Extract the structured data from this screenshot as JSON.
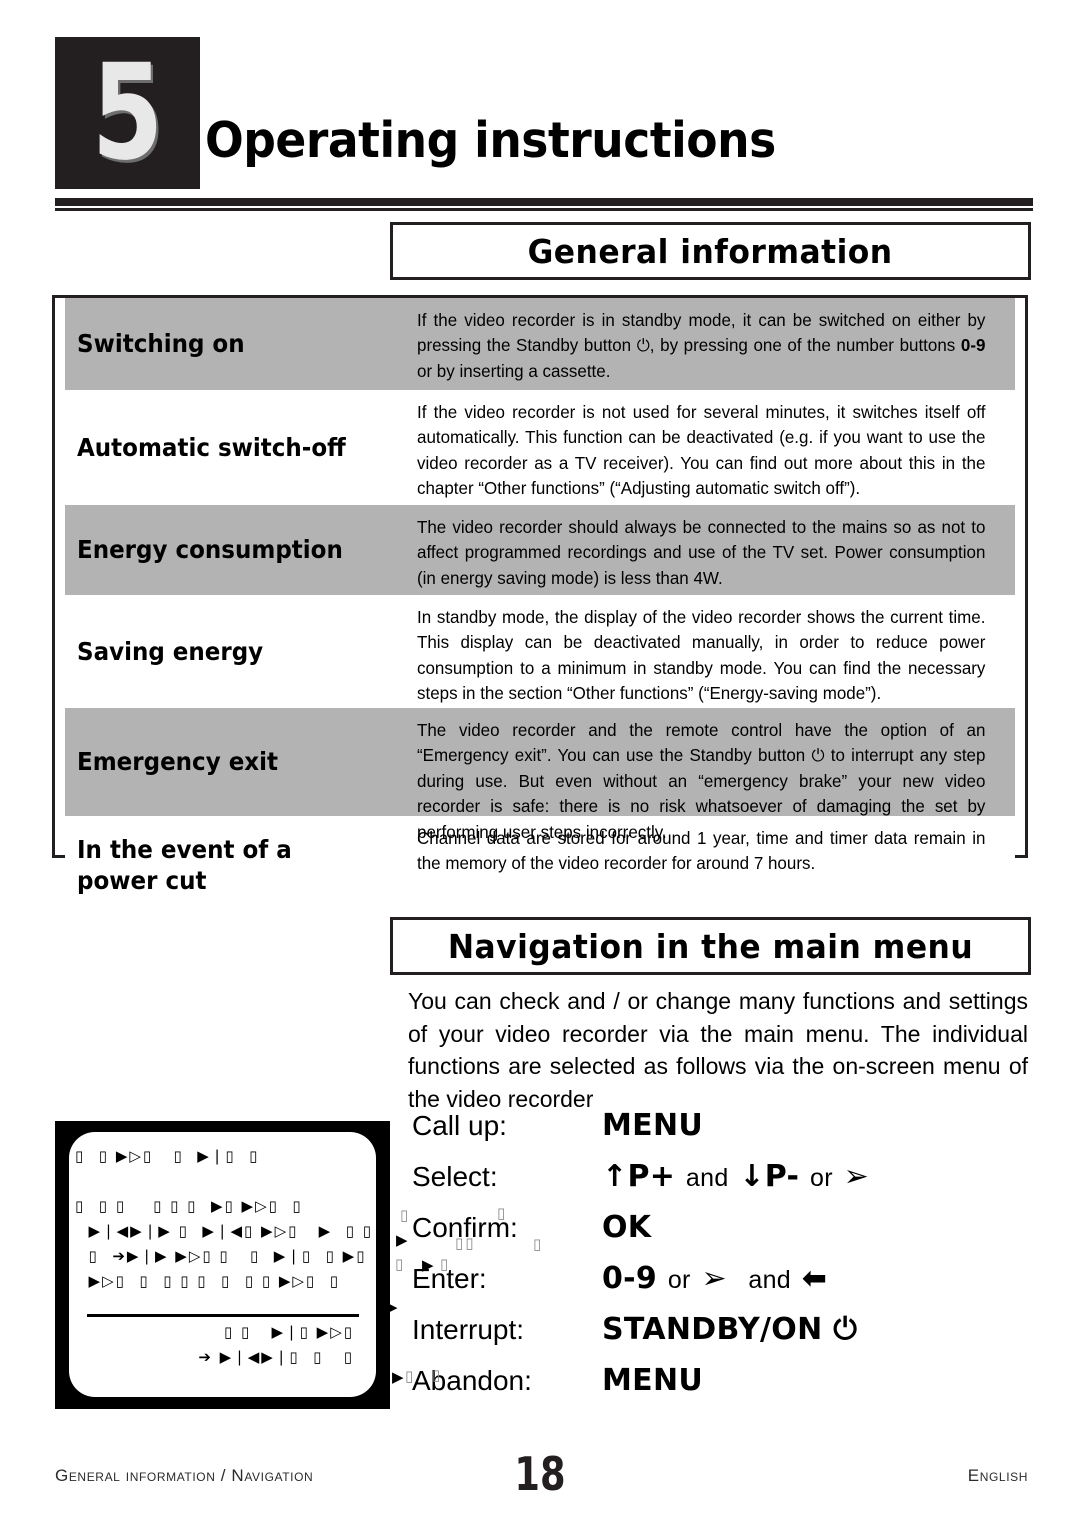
{
  "header": {
    "chapter_number": "5",
    "chapter_title": "Operating instructions"
  },
  "sections": {
    "general_title": "General information",
    "navigation_title": "Navigation in the main menu"
  },
  "info_table": {
    "rows": [
      {
        "label": "Switching on",
        "shaded": true,
        "body": "If the video recorder is in standby mode, it can be switched on either by pressing the Standby button ⏻, by pressing one of the number buttons 0-9 or by inserting a cassette."
      },
      {
        "label": "Automatic switch-off",
        "shaded": false,
        "body": "If the video recorder is not used for several minutes, it switches itself off automatically. This function can be deactivated (e.g. if you want to use the video recorder as a TV receiver). You can find out more about this in the chapter “Other functions” (“Adjusting automatic switch off”)."
      },
      {
        "label": "Energy consumption",
        "shaded": true,
        "body": "The video recorder should always be connected to the mains so as not to affect programmed recordings and use of the TV set. Power consumption (in energy saving mode) is less than 4W."
      },
      {
        "label": "Saving energy",
        "shaded": false,
        "body": "In standby mode, the display of the video recorder shows the current time. This display can be deactivated manually, in order to reduce power consumption to a minimum in standby mode. You can find the necessary steps in the section “Other functions”  (“Energy-saving mode”)."
      },
      {
        "label": "Emergency exit",
        "shaded": true,
        "body": "The video recorder and the remote control have the option of an “Emergency exit”. You can use the Standby button ⏻ to interrupt any step during use. But even without an “emergency brake” your new video recorder is safe: there is no risk whatsoever of damaging the set by performing user steps incorrectly."
      },
      {
        "label": "In the event of a\npower cut",
        "shaded": false,
        "body": "Channel data are stored for around 1 year, time and timer data remain in the memory of the video recorder for around 7 hours."
      }
    ]
  },
  "navigation": {
    "intro": "You can check and / or change many functions and settings of your video recorder via the main menu. The individual functions are selected as follows via the on-screen menu of the video recorder",
    "commands": [
      {
        "label": "Call up:",
        "value": "MENU"
      },
      {
        "label": "Select:",
        "value": "↑P+ and ↓P- or ➔"
      },
      {
        "label": "Confirm:",
        "value": "OK"
      },
      {
        "label": "Enter:",
        "value": "0-9 or ➔  and ⬅"
      },
      {
        "label": "Interrupt:",
        "value": "STANDBY/ON ⏻"
      },
      {
        "label": "Abandon:",
        "value": "MENU"
      }
    ]
  },
  "tv_figure": {
    "note": "on-screen menu illustration with unrenderable font glyphs",
    "lines": [
      "▯  ▯ ▶▷▯   ▯  ▶❘▯  ▯",
      "",
      "▯  ▯ ▯    ▯ ▯ ▯  ▶▯ ▶▷▯  ▯",
      "  ▶❘◀▶❘▶ ▯  ▶❘◀▯ ▶▷▯   ▶  ▯ ▯ ▯",
      "  ▯  ➔▶❘▶ ▶▷▯ ▯   ▯  ▶❘▯  ▯ ▶▯",
      "  ▶▷▯  ▯  ▯ ▯ ▯  ▯  ▯ ▯ ▶▷▯  ▯"
    ],
    "footer_lines": [
      "▯ ▯   ▶❘▯ ▶▷▯",
      "➔ ▶❘◀▶❘▯  ▯   ▯"
    ]
  },
  "footer": {
    "left": "General information / Navigation",
    "page": "18",
    "right": "English"
  }
}
